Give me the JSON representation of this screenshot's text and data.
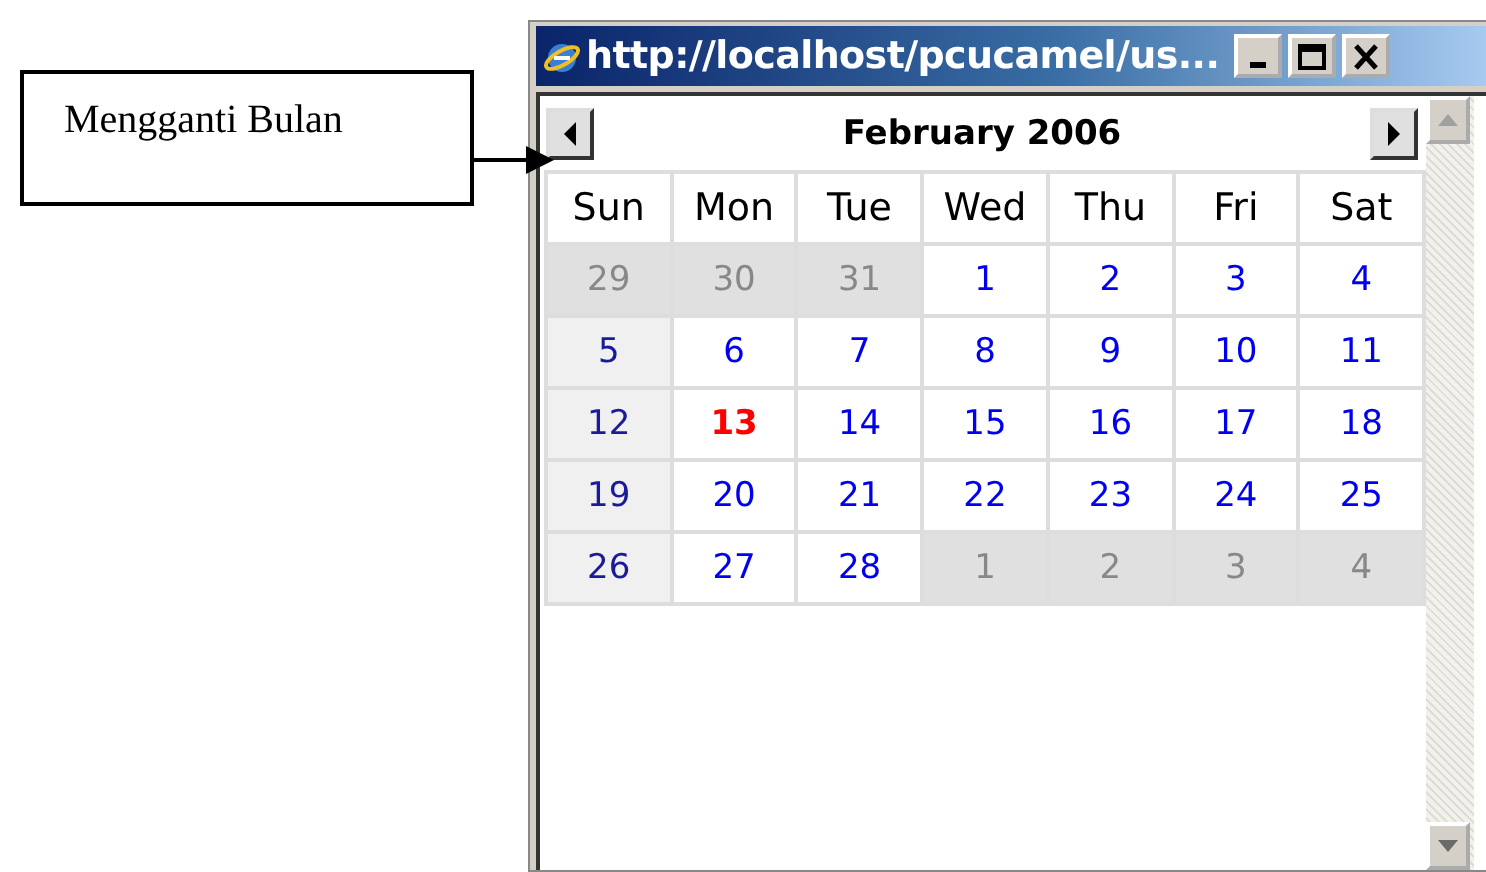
{
  "callout": {
    "text": "Mengganti Bulan"
  },
  "window": {
    "title": "http://localhost/pcucamel/us..."
  },
  "calendar": {
    "month": "February 2006",
    "columns": [
      {
        "label": "Sun",
        "weekend": true
      },
      {
        "label": "Mon",
        "weekend": false
      },
      {
        "label": "Tue",
        "weekend": false
      },
      {
        "label": "Wed",
        "weekend": false
      },
      {
        "label": "Thu",
        "weekend": false
      },
      {
        "label": "Fri",
        "weekend": false
      },
      {
        "label": "Sat",
        "weekend": false
      }
    ],
    "weeks": [
      [
        {
          "day": "29",
          "kind": "other"
        },
        {
          "day": "30",
          "kind": "other"
        },
        {
          "day": "31",
          "kind": "other"
        },
        {
          "day": "1",
          "kind": "current"
        },
        {
          "day": "2",
          "kind": "current"
        },
        {
          "day": "3",
          "kind": "current"
        },
        {
          "day": "4",
          "kind": "current"
        }
      ],
      [
        {
          "day": "5",
          "kind": "current"
        },
        {
          "day": "6",
          "kind": "current"
        },
        {
          "day": "7",
          "kind": "current"
        },
        {
          "day": "8",
          "kind": "current"
        },
        {
          "day": "9",
          "kind": "current"
        },
        {
          "day": "10",
          "kind": "current"
        },
        {
          "day": "11",
          "kind": "current"
        }
      ],
      [
        {
          "day": "12",
          "kind": "current"
        },
        {
          "day": "13",
          "kind": "today"
        },
        {
          "day": "14",
          "kind": "current"
        },
        {
          "day": "15",
          "kind": "current"
        },
        {
          "day": "16",
          "kind": "current"
        },
        {
          "day": "17",
          "kind": "current"
        },
        {
          "day": "18",
          "kind": "current"
        }
      ],
      [
        {
          "day": "19",
          "kind": "current"
        },
        {
          "day": "20",
          "kind": "current"
        },
        {
          "day": "21",
          "kind": "current"
        },
        {
          "day": "22",
          "kind": "current"
        },
        {
          "day": "23",
          "kind": "current"
        },
        {
          "day": "24",
          "kind": "current"
        },
        {
          "day": "25",
          "kind": "current"
        }
      ],
      [
        {
          "day": "26",
          "kind": "current"
        },
        {
          "day": "27",
          "kind": "current"
        },
        {
          "day": "28",
          "kind": "current"
        },
        {
          "day": "1",
          "kind": "other"
        },
        {
          "day": "2",
          "kind": "other"
        },
        {
          "day": "3",
          "kind": "other"
        },
        {
          "day": "4",
          "kind": "other"
        }
      ]
    ]
  }
}
